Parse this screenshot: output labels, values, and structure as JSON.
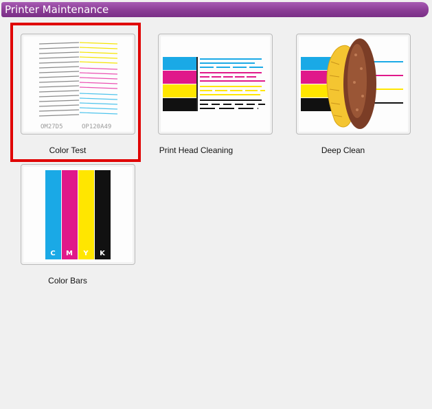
{
  "window": {
    "title": "Printer Maintenance"
  },
  "options": [
    {
      "label": "Color Test",
      "selected": true,
      "nozzle_codes": [
        "OM27D5",
        "OP120A49"
      ]
    },
    {
      "label": "Print Head Cleaning",
      "selected": false
    },
    {
      "label": "Deep Clean",
      "selected": false
    },
    {
      "label": "Color Bars",
      "selected": false,
      "bar_letters": [
        "C",
        "M",
        "Y",
        "K"
      ]
    }
  ],
  "colors": {
    "accent": "#8a3c95",
    "selection": "#e00000",
    "cyan": "#1aa9e6",
    "magenta": "#e0188a",
    "yellow": "#ffe600",
    "black": "#111111"
  }
}
